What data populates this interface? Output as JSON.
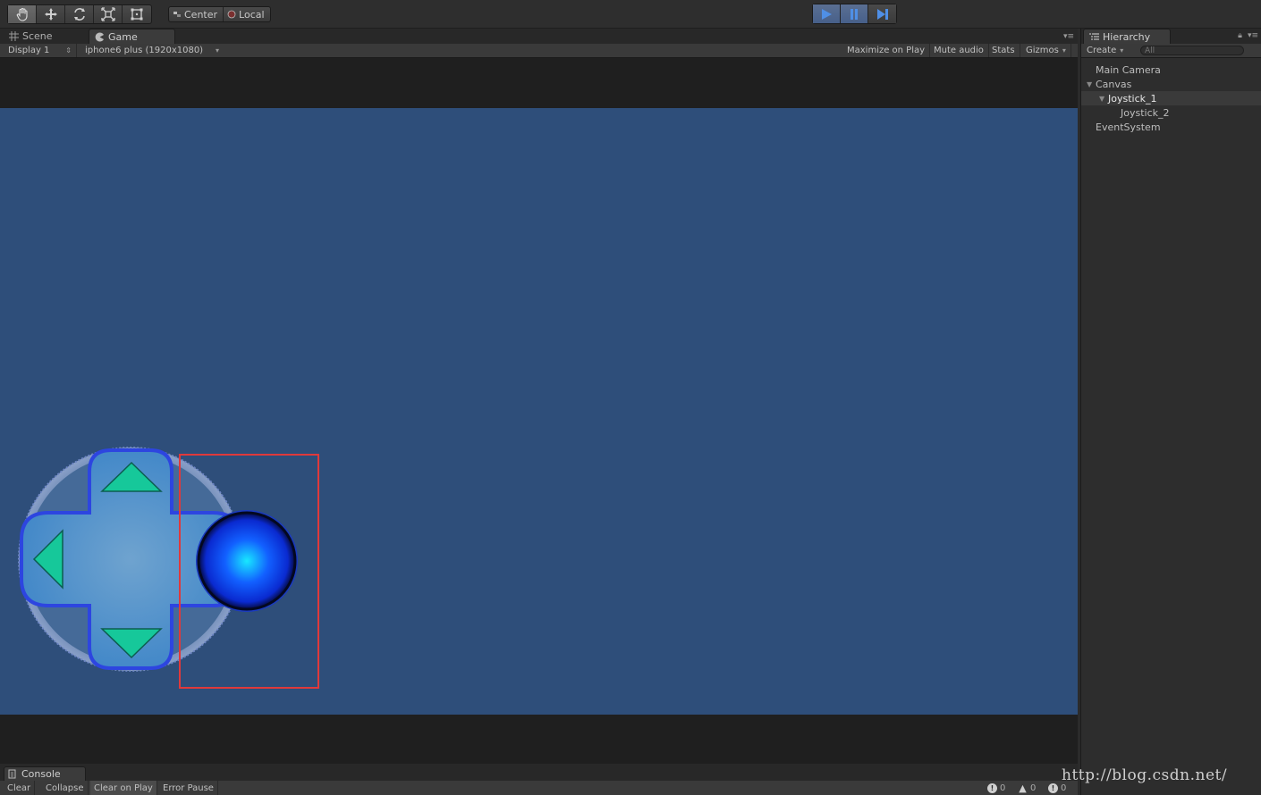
{
  "toolbar": {
    "tools": [
      "hand-tool",
      "move-tool",
      "rotate-tool",
      "scale-tool",
      "rect-tool"
    ],
    "pivot_center": "Center",
    "pivot_local": "Local"
  },
  "game_panel": {
    "tab_scene": "Scene",
    "tab_game": "Game",
    "display": "Display 1",
    "resolution": "iphone6 plus (1920x1080)",
    "maximize_on_play": "Maximize on Play",
    "mute_audio": "Mute audio",
    "stats": "Stats",
    "gizmos": "Gizmos",
    "background_color": "#2e4e7a"
  },
  "hierarchy": {
    "title": "Hierarchy",
    "create": "Create",
    "search_placeholder": "All",
    "items": [
      {
        "label": "Main Camera",
        "depth": 0
      },
      {
        "label": "Canvas",
        "depth": 0
      },
      {
        "label": "Joystick_1",
        "depth": 1
      },
      {
        "label": "Joystick_2",
        "depth": 2
      },
      {
        "label": "EventSystem",
        "depth": 0
      }
    ]
  },
  "console": {
    "tab": "Console",
    "clear": "Clear",
    "collapse": "Collapse",
    "clear_on_play": "Clear on Play",
    "error_pause": "Error Pause",
    "errors": "0",
    "warnings": "0",
    "messages": "0"
  },
  "watermark": "http://blog.csdn.net/",
  "colors": {
    "accent_play": "#4f8fe6",
    "selection": "#e0393b",
    "joystick_arrow": "#16c89a"
  }
}
